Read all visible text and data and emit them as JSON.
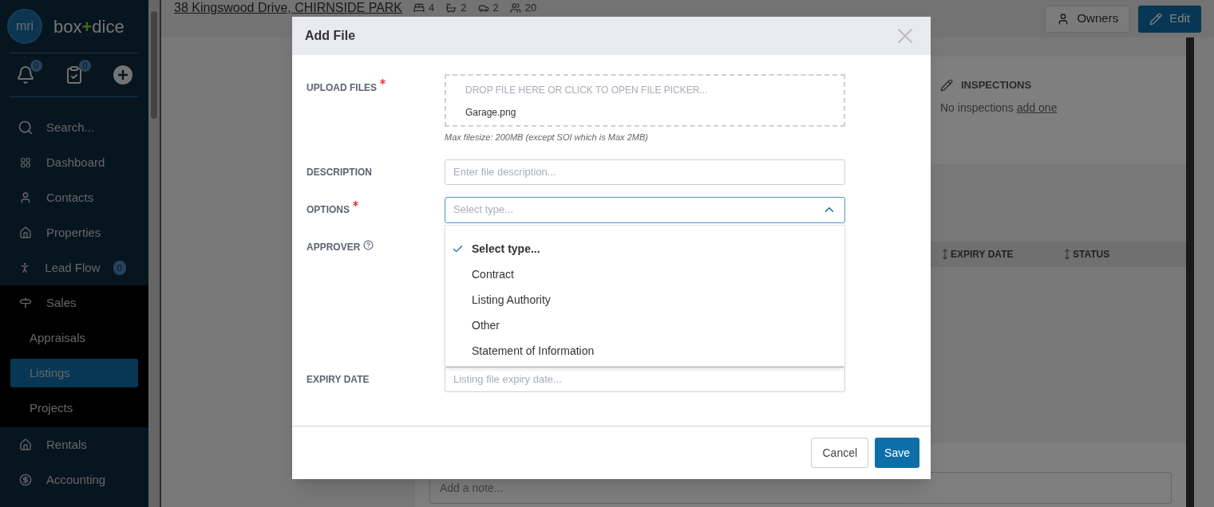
{
  "sidebar": {
    "logo_text": "mri",
    "brand": [
      "box",
      "+",
      "dice"
    ],
    "counters": [
      {
        "kind": "bell",
        "count": "0"
      },
      {
        "kind": "tasks",
        "count": "0"
      },
      {
        "kind": "add"
      }
    ],
    "items": [
      {
        "kind": "search",
        "label": "Search...",
        "selected": false
      },
      {
        "kind": "dashboard",
        "label": "Dashboard",
        "selected": false
      },
      {
        "kind": "contacts",
        "label": "Contacts",
        "selected": false
      },
      {
        "kind": "properties",
        "label": "Properties",
        "selected": false
      },
      {
        "kind": "leads",
        "label": "Lead Flow",
        "badge": "0",
        "selected": false
      },
      {
        "kind": "sales",
        "label": "Sales",
        "selected": false,
        "expanded": true,
        "children": [
          {
            "label": "Appraisals",
            "selected": false
          },
          {
            "label": "Listings",
            "selected": true
          },
          {
            "label": "Projects",
            "selected": false
          }
        ]
      },
      {
        "kind": "rentals",
        "label": "Rentals",
        "selected": false
      },
      {
        "kind": "accounting",
        "label": "Accounting",
        "selected": false
      }
    ]
  },
  "header": {
    "title": "38 Kingswood Drive, CHIRNSIDE PARK",
    "stats": [
      {
        "kind": "bed",
        "value": "4"
      },
      {
        "kind": "bath",
        "value": "2"
      },
      {
        "kind": "car",
        "value": "2"
      },
      {
        "kind": "people",
        "value": "20"
      }
    ],
    "buttons": [
      {
        "kind": "plain",
        "label": "Owners"
      },
      {
        "kind": "primary",
        "label": "Edit"
      }
    ]
  },
  "inspections": {
    "title": "INSPECTIONS",
    "text": "No inspections",
    "link": "add one"
  },
  "table": {
    "columns": [
      "EXPIRY DATE",
      "STATUS"
    ]
  },
  "note": {
    "placeholder": "Add a note..."
  },
  "dialog": {
    "title": "Add File",
    "fields": [
      {
        "kind": "upload",
        "label": "UPLOAD FILES",
        "required": true,
        "hint": "DROP FILE HERE OR CLICK TO OPEN FILE PICKER...",
        "files": [
          "Garage.png"
        ],
        "help": "Max filesize: 200MB (except SOI which is Max 2MB)"
      },
      {
        "kind": "text",
        "label": "DESCRIPTION",
        "required": false,
        "placeholder": "Enter file description..."
      },
      {
        "kind": "select",
        "label": "OPTIONS",
        "required": true,
        "placeholder": "Select type...",
        "expanded": true,
        "options": [
          {
            "label": "Select type...",
            "selected": true
          },
          {
            "label": "Contract",
            "selected": false
          },
          {
            "label": "Listing Authority",
            "selected": false
          },
          {
            "label": "Other",
            "selected": false
          },
          {
            "label": "Statement of Information",
            "selected": false
          }
        ]
      },
      {
        "kind": "approver",
        "label": "APPROVER",
        "required": false
      },
      {
        "kind": "date",
        "label": "EXPIRY DATE",
        "required": false,
        "placeholder": "Listing file expiry date..."
      }
    ],
    "buttons": [
      {
        "kind": "secondary",
        "label": "Cancel"
      },
      {
        "kind": "primary",
        "label": "Save"
      }
    ]
  }
}
